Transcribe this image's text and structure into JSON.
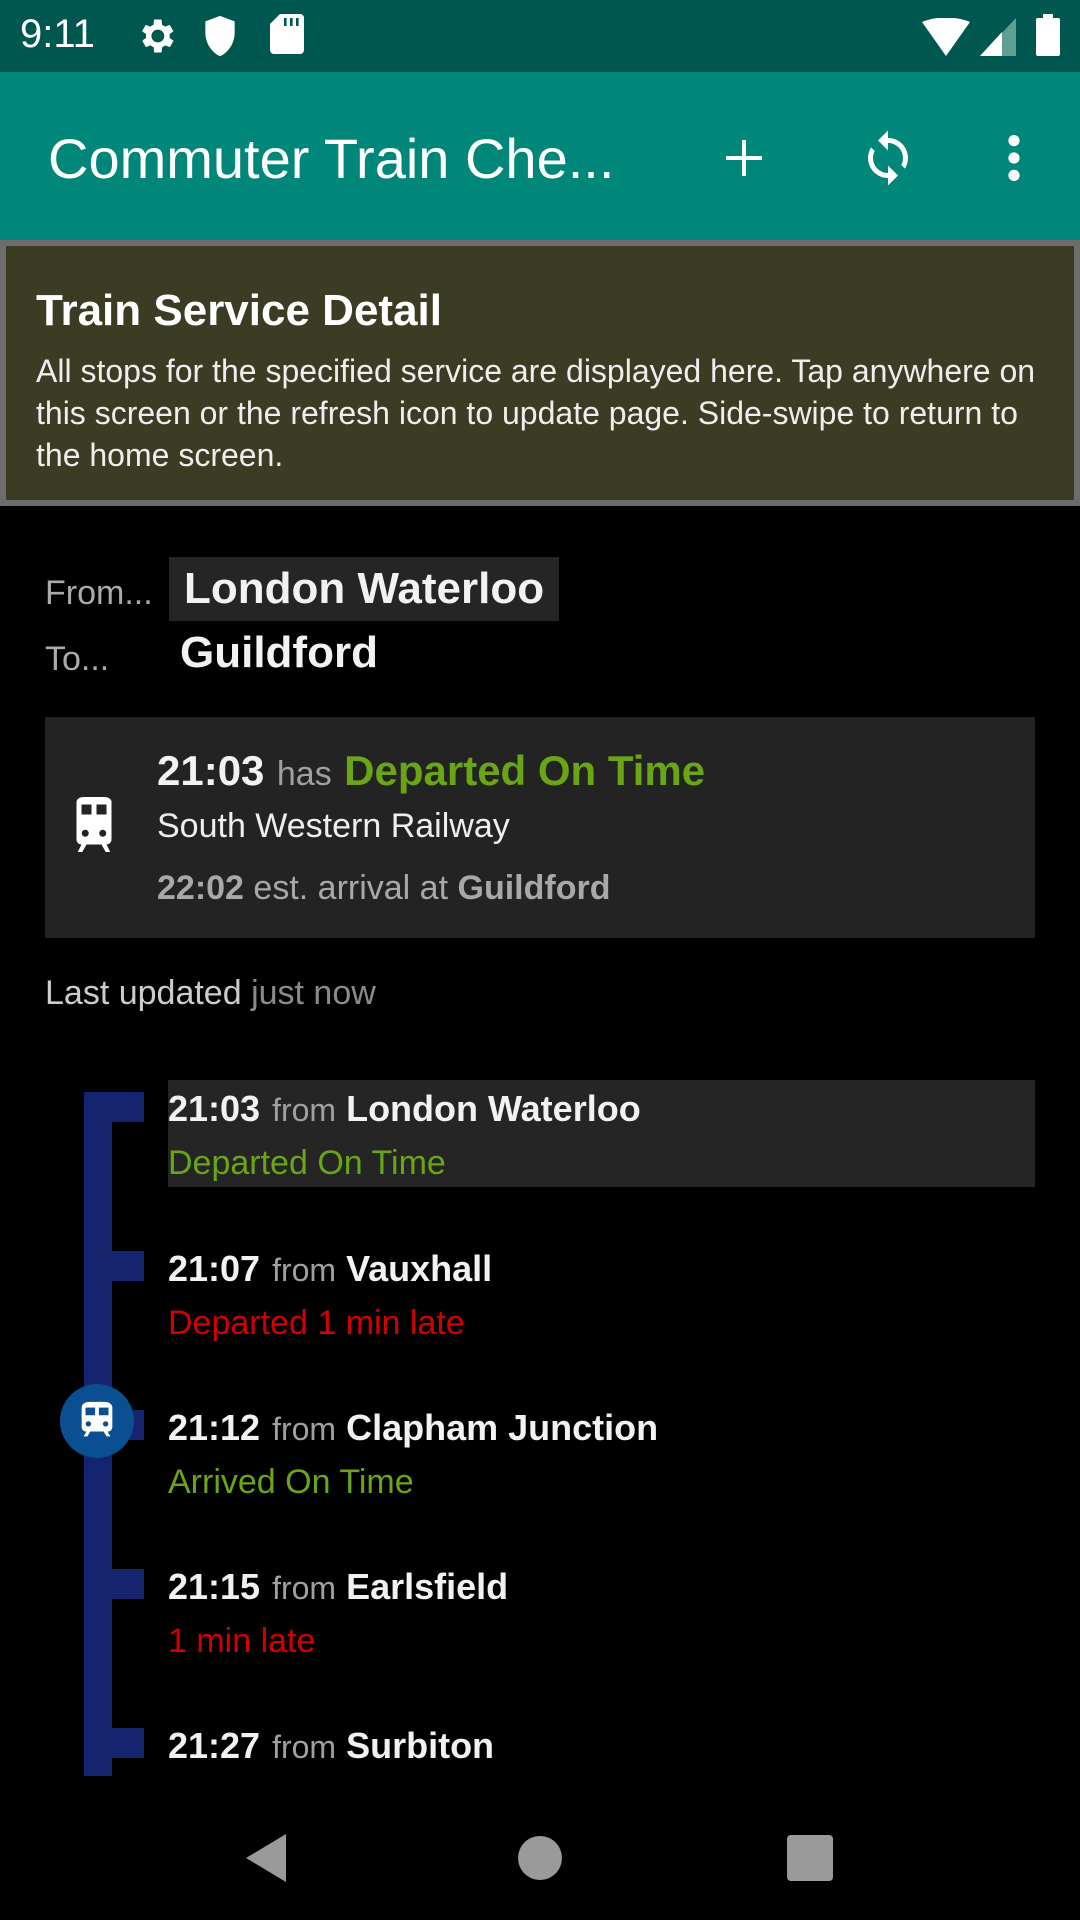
{
  "status_bar": {
    "time": "9:11",
    "left_icons": [
      "gear-icon",
      "shield-icon",
      "sd-card-icon"
    ],
    "right_icons": [
      "wifi-icon",
      "signal-icon",
      "battery-icon"
    ]
  },
  "app_bar": {
    "title": "Commuter Train Che...",
    "actions": [
      "add-icon",
      "refresh-icon",
      "more-vert-icon"
    ],
    "color": "#00877a"
  },
  "info_panel": {
    "title": "Train Service Detail",
    "body": "All stops for the specified service are displayed here. Tap anywhere on this screen or the refresh icon to update page. Side-swipe to return to the home screen."
  },
  "route": {
    "from_label": "From...",
    "from_value": "London Waterloo",
    "to_label": "To...",
    "to_value": "Guildford"
  },
  "service_card": {
    "time": "21:03",
    "has": "has",
    "status": "Departed On Time",
    "operator": "South Western Railway",
    "arrival_time": "22:02",
    "arrival_text": "est. arrival at",
    "arrival_station": "Guildford"
  },
  "last_updated": {
    "label": "Last updated",
    "value": "just now"
  },
  "stops": [
    {
      "time": "21:03",
      "from": "from",
      "station": "London Waterloo",
      "status": "Departed On Time",
      "status_type": "ok"
    },
    {
      "time": "21:07",
      "from": "from",
      "station": "Vauxhall",
      "status": "Departed 1 min late",
      "status_type": "late"
    },
    {
      "time": "21:12",
      "from": "from",
      "station": "Clapham Junction",
      "status": "Arrived On Time",
      "status_type": "ok"
    },
    {
      "time": "21:15",
      "from": "from",
      "station": "Earlsfield",
      "status": "1 min late",
      "status_type": "late"
    },
    {
      "time": "21:27",
      "from": "from",
      "station": "Surbiton",
      "status": "",
      "status_type": ""
    }
  ],
  "colors": {
    "on_time": "#6aa516",
    "late": "#d20000",
    "timeline": "#15246e",
    "train_marker": "#0b4f93"
  }
}
